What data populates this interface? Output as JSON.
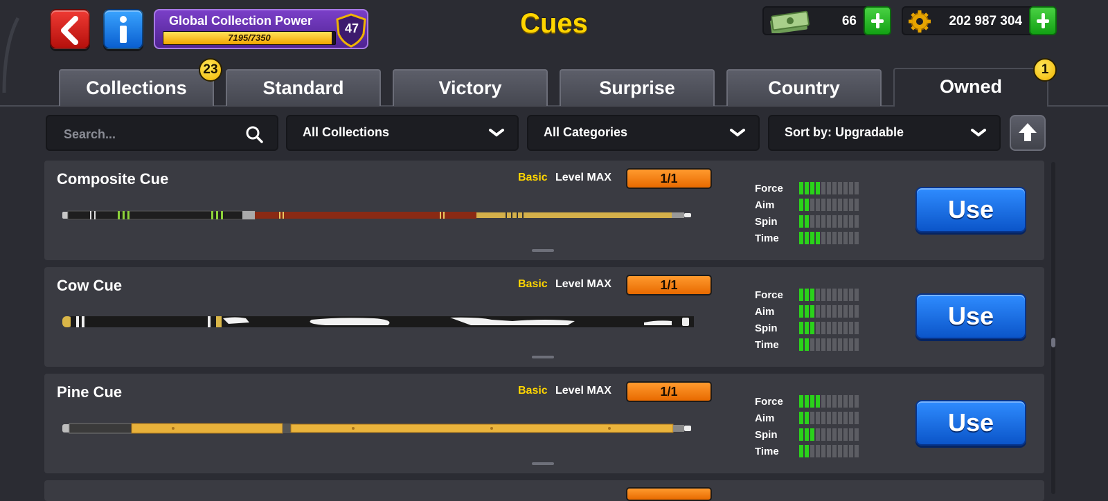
{
  "header": {
    "title": "Cues",
    "collection_power": {
      "label": "Global Collection Power",
      "progress": "7195/7350",
      "level": "47",
      "fill_fraction": 0.979
    },
    "cash": {
      "value": "66",
      "icon": "cash-icon"
    },
    "coins": {
      "value": "202 987 304",
      "icon": "coin-gear-icon"
    }
  },
  "tabs": [
    {
      "label": "Collections",
      "badge": "23"
    },
    {
      "label": "Standard"
    },
    {
      "label": "Victory"
    },
    {
      "label": "Surprise"
    },
    {
      "label": "Country"
    },
    {
      "label": "Owned",
      "badge": "1",
      "active": true
    }
  ],
  "filters": {
    "search_placeholder": "Search...",
    "collection": "All Collections",
    "category": "All Categories",
    "sort": "Sort by: Upgradable"
  },
  "stat_labels": [
    "Force",
    "Aim",
    "Spin",
    "Time"
  ],
  "cues": [
    {
      "name": "Composite Cue",
      "rarity": "Basic",
      "level": "Level MAX",
      "progress": "1/1",
      "stats": [
        4,
        2,
        2,
        4
      ],
      "action": "Use"
    },
    {
      "name": "Cow Cue",
      "rarity": "Basic",
      "level": "Level MAX",
      "progress": "1/1",
      "stats": [
        3,
        3,
        3,
        2
      ],
      "action": "Use"
    },
    {
      "name": "Pine Cue",
      "rarity": "Basic",
      "level": "Level MAX",
      "progress": "1/1",
      "stats": [
        4,
        2,
        3,
        2
      ],
      "action": "Use"
    }
  ],
  "colors": {
    "accent_yellow": "#ffd500",
    "stat_green": "#2ad21a",
    "use_blue": "#1a6fe8",
    "level_orange": "#f5820f"
  }
}
